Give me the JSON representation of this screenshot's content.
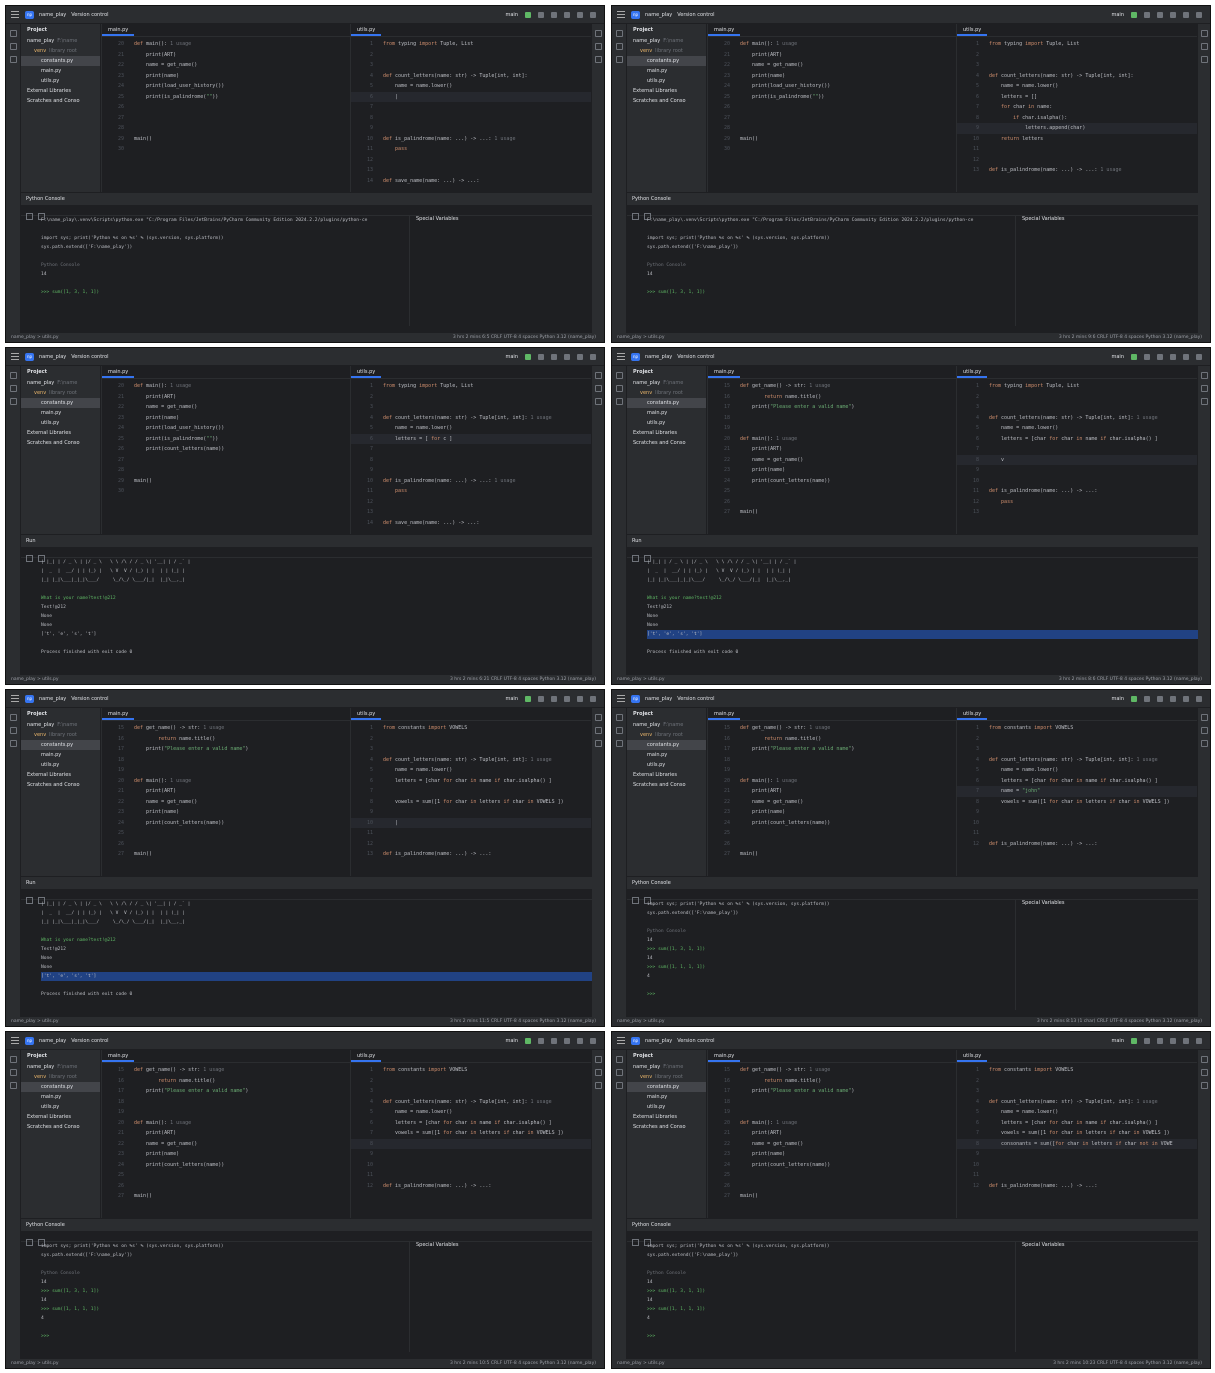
{
  "ide": {
    "project_badge": "np",
    "project_name": "name_play",
    "vcs": "Version control",
    "branch": "main",
    "panel_title": "Project",
    "tree": [
      {
        "label": "name_play",
        "suffix": "F:\\name",
        "indent": 0,
        "sel": false
      },
      {
        "label": "venv",
        "suffix": "library root",
        "indent": 1,
        "sel": false,
        "folder": true
      },
      {
        "label": "constants.py",
        "suffix": "",
        "indent": 2,
        "sel": true
      },
      {
        "label": "main.py",
        "suffix": "",
        "indent": 2,
        "sel": false
      },
      {
        "label": "utils.py",
        "suffix": "",
        "indent": 2,
        "sel": false
      },
      {
        "label": "External Libraries",
        "suffix": "",
        "indent": 0,
        "sel": false
      },
      {
        "label": "Scratches and Conso",
        "suffix": "",
        "indent": 0,
        "sel": false
      }
    ],
    "tab_main": "main.py",
    "tab_utils": "utils.py",
    "status_crumb": "name_play > utils.py",
    "console_title": "Python Console",
    "run_title": "Run",
    "run_config": "main",
    "special_vars": "Special Variables"
  },
  "code": {
    "main_a": [
      {
        "n": "20",
        "t": "def main(): 1 usage"
      },
      {
        "n": "21",
        "t": "    print(ART)"
      },
      {
        "n": "22",
        "t": "    name = get_name()"
      },
      {
        "n": "23",
        "t": "    print(name)"
      },
      {
        "n": "24",
        "t": "    print(load_user_history())"
      },
      {
        "n": "25",
        "t": "    print(is_palindrome(\"\"))"
      },
      {
        "n": "26",
        "t": ""
      },
      {
        "n": "27",
        "t": ""
      },
      {
        "n": "28",
        "t": ""
      },
      {
        "n": "29",
        "t": "main()"
      },
      {
        "n": "30",
        "t": ""
      }
    ],
    "main_b": [
      {
        "n": "20",
        "t": "def main(): 1 usage"
      },
      {
        "n": "21",
        "t": "    print(ART)"
      },
      {
        "n": "22",
        "t": "    name = get_name()"
      },
      {
        "n": "23",
        "t": "    print(name)"
      },
      {
        "n": "24",
        "t": "    print(load_user_history())"
      },
      {
        "n": "25",
        "t": "    print(is_palindrome(\"\"))"
      },
      {
        "n": "26",
        "t": "    print(count_letters(name))"
      },
      {
        "n": "27",
        "t": ""
      },
      {
        "n": "28",
        "t": ""
      },
      {
        "n": "29",
        "t": "main()"
      },
      {
        "n": "30",
        "t": ""
      }
    ],
    "main_c": [
      {
        "n": "15",
        "t": "def get_name() -> str: 1 usage"
      },
      {
        "n": "16",
        "t": "        return name.title()"
      },
      {
        "n": "17",
        "t": "    print(\"Please enter a valid name\")"
      },
      {
        "n": "18",
        "t": ""
      },
      {
        "n": "19",
        "t": ""
      },
      {
        "n": "20",
        "t": "def main(): 1 usage"
      },
      {
        "n": "21",
        "t": "    print(ART)"
      },
      {
        "n": "22",
        "t": "    name = get_name()"
      },
      {
        "n": "23",
        "t": "    print(name)"
      },
      {
        "n": "24",
        "t": "    print(count_letters(name))"
      },
      {
        "n": "25",
        "t": ""
      },
      {
        "n": "26",
        "t": ""
      },
      {
        "n": "27",
        "t": "main()"
      }
    ],
    "utils_1": [
      {
        "n": "1",
        "t": "from typing import Tuple, List"
      },
      {
        "n": "2",
        "t": ""
      },
      {
        "n": "3",
        "t": ""
      },
      {
        "n": "4",
        "t": "def count_letters(name: str) -> Tuple[int, int]:"
      },
      {
        "n": "5",
        "t": "    name = name.lower()"
      },
      {
        "n": "6",
        "t": "    |"
      },
      {
        "n": "7",
        "t": ""
      },
      {
        "n": "8",
        "t": ""
      },
      {
        "n": "9",
        "t": ""
      },
      {
        "n": "10",
        "t": "def is_palindrome(name: ...) -> ...: 1 usage"
      },
      {
        "n": "11",
        "t": "    pass"
      },
      {
        "n": "12",
        "t": ""
      },
      {
        "n": "13",
        "t": ""
      },
      {
        "n": "14",
        "t": "def save_name(name: ...) -> ...:"
      }
    ],
    "utils_2": [
      {
        "n": "1",
        "t": "from typing import Tuple, List"
      },
      {
        "n": "2",
        "t": ""
      },
      {
        "n": "3",
        "t": ""
      },
      {
        "n": "4",
        "t": "def count_letters(name: str) -> Tuple[int, int]:"
      },
      {
        "n": "5",
        "t": "    name = name.lower()"
      },
      {
        "n": "6",
        "t": "    letters = []"
      },
      {
        "n": "7",
        "t": "    for char in name:"
      },
      {
        "n": "8",
        "t": "        if char.isalpha():"
      },
      {
        "n": "9",
        "t": "            letters.append(char)"
      },
      {
        "n": "10",
        "t": "    return letters"
      },
      {
        "n": "11",
        "t": ""
      },
      {
        "n": "12",
        "t": ""
      },
      {
        "n": "13",
        "t": "def is_palindrome(name: ...) -> ...: 1 usage"
      }
    ],
    "utils_3": [
      {
        "n": "1",
        "t": "from typing import Tuple, List"
      },
      {
        "n": "2",
        "t": ""
      },
      {
        "n": "3",
        "t": ""
      },
      {
        "n": "4",
        "t": "def count_letters(name: str) -> Tuple[int, int]: 1 usage"
      },
      {
        "n": "5",
        "t": "    name = name.lower()"
      },
      {
        "n": "6",
        "t": "    letters = [ for c ]"
      },
      {
        "n": "7",
        "t": ""
      },
      {
        "n": "8",
        "t": ""
      },
      {
        "n": "9",
        "t": ""
      },
      {
        "n": "10",
        "t": "def is_palindrome(name: ...) -> ...: 1 usage"
      },
      {
        "n": "11",
        "t": "    pass"
      },
      {
        "n": "12",
        "t": ""
      },
      {
        "n": "13",
        "t": ""
      },
      {
        "n": "14",
        "t": "def save_name(name: ...) -> ...:"
      }
    ],
    "utils_4": [
      {
        "n": "1",
        "t": "from typing import Tuple, List"
      },
      {
        "n": "2",
        "t": ""
      },
      {
        "n": "3",
        "t": ""
      },
      {
        "n": "4",
        "t": "def count_letters(name: str) -> Tuple[int, int]: 1 usage"
      },
      {
        "n": "5",
        "t": "    name = name.lower()"
      },
      {
        "n": "6",
        "t": "    letters = [char for char in name if char.isalpha() ]"
      },
      {
        "n": "7",
        "t": ""
      },
      {
        "n": "8",
        "t": "    v"
      },
      {
        "n": "9",
        "t": ""
      },
      {
        "n": "10",
        "t": ""
      },
      {
        "n": "11",
        "t": "def is_palindrome(name: ...) -> ...:"
      },
      {
        "n": "12",
        "t": "    pass"
      },
      {
        "n": "13",
        "t": ""
      }
    ],
    "utils_5": [
      {
        "n": "1",
        "t": "from constants import VOWELS"
      },
      {
        "n": "2",
        "t": ""
      },
      {
        "n": "3",
        "t": ""
      },
      {
        "n": "4",
        "t": "def count_letters(name: str) -> Tuple[int, int]: 1 usage"
      },
      {
        "n": "5",
        "t": "    name = name.lower()"
      },
      {
        "n": "6",
        "t": "    letters = [char for char in name if char.isalpha() ]"
      },
      {
        "n": "7",
        "t": ""
      },
      {
        "n": "8",
        "t": "    vowels = sum([1 for char in letters if char in VOWELS ])"
      },
      {
        "n": "9",
        "t": ""
      },
      {
        "n": "10",
        "t": "    |"
      },
      {
        "n": "11",
        "t": ""
      },
      {
        "n": "12",
        "t": ""
      },
      {
        "n": "13",
        "t": "def is_palindrome(name: ...) -> ...:"
      }
    ],
    "utils_6": [
      {
        "n": "1",
        "t": "from constants import VOWELS"
      },
      {
        "n": "2",
        "t": ""
      },
      {
        "n": "3",
        "t": ""
      },
      {
        "n": "4",
        "t": "def count_letters(name: str) -> Tuple[int, int]: 1 usage"
      },
      {
        "n": "5",
        "t": "    name = name.lower()"
      },
      {
        "n": "6",
        "t": "    letters = [char for char in name if char.isalpha() ]"
      },
      {
        "n": "7",
        "t": "    name = \"john\""
      },
      {
        "n": "8",
        "t": "    vowels = sum([1 for char in letters if char in VOWELS ])"
      },
      {
        "n": "9",
        "t": ""
      },
      {
        "n": "10",
        "t": ""
      },
      {
        "n": "11",
        "t": ""
      },
      {
        "n": "12",
        "t": "def is_palindrome(name: ...) -> ...:"
      }
    ],
    "utils_7": [
      {
        "n": "1",
        "t": "from constants import VOWELS"
      },
      {
        "n": "2",
        "t": ""
      },
      {
        "n": "3",
        "t": ""
      },
      {
        "n": "4",
        "t": "def count_letters(name: str) -> Tuple[int, int]: 1 usage"
      },
      {
        "n": "5",
        "t": "    name = name.lower()"
      },
      {
        "n": "6",
        "t": "    letters = [char for char in name if char.isalpha() ]"
      },
      {
        "n": "7",
        "t": "    vowels = sum([1 for char in letters if char in VOWELS ])"
      },
      {
        "n": "8",
        "t": ""
      },
      {
        "n": "9",
        "t": ""
      },
      {
        "n": "10",
        "t": ""
      },
      {
        "n": "11",
        "t": ""
      },
      {
        "n": "12",
        "t": "def is_palindrome(name: ...) -> ...:"
      }
    ],
    "utils_8": [
      {
        "n": "1",
        "t": "from constants import VOWELS"
      },
      {
        "n": "2",
        "t": ""
      },
      {
        "n": "3",
        "t": ""
      },
      {
        "n": "4",
        "t": "def count_letters(name: str) -> Tuple[int, int]: 1 usage"
      },
      {
        "n": "5",
        "t": "    name = name.lower()"
      },
      {
        "n": "6",
        "t": "    letters = [char for char in name if char.isalpha() ]"
      },
      {
        "n": "7",
        "t": "    vowels = sum([1 for char in letters if char in VOWELS ])"
      },
      {
        "n": "8",
        "t": "    consonants = sum([for char in letters if char not in VOWE"
      },
      {
        "n": "9",
        "t": ""
      },
      {
        "n": "10",
        "t": ""
      },
      {
        "n": "11",
        "t": ""
      },
      {
        "n": "12",
        "t": "def is_palindrome(name: ...) -> ...:"
      }
    ]
  },
  "consoles": {
    "c1": [
      "F:\\name_play\\.venv\\Scripts\\python.exe \"C:/Program Files/JetBrains/PyCharm Community Edition 2024.2.2/plugins/python-ce",
      "",
      "import sys; print('Python %s on %s' % (sys.version, sys.platform))",
      "sys.path.extend(['F:\\name_play'])",
      "",
      "Python Console",
      "14",
      "",
      ">>> sum([1, 3, 1, 1])"
    ],
    "c2": [
      "F:\\name_play\\.venv\\Scripts\\python.exe \"C:/Program Files/JetBrains/PyCharm Community Edition 2024.2.2/plugins/python-ce",
      "",
      "import sys; print('Python %s on %s' % (sys.version, sys.platform))",
      "sys.path.extend(['F:\\name_play'])",
      "",
      "Python Console",
      "14",
      "",
      ">>> sum([1, 3, 1, 1])"
    ],
    "run1": [
      "| |_| | / _ \\ | |/ _ \\   \\ \\ /\\ / / _ \\| '__| | / _` |",
      "|  _  |  __/ | | (_) |   \\ V  V / (_) | |  | | (_| |",
      "|_| |_|\\___|_|_|\\___/     \\_/\\_/ \\___/|_|  |_|\\__,_|",
      "",
      "What is your name?test!@212",
      "Test!@212",
      "None",
      "None",
      "['t', 'e', 's', 't']",
      "",
      "Process finished with exit code 0"
    ],
    "c3": [
      "import sys; print('Python %s on %s' % (sys.version, sys.platform))",
      "sys.path.extend(['F:\\name_play'])",
      "",
      "Python Console",
      "14",
      ">>> sum([1, 3, 1, 1])",
      "14",
      ">>> sum([1, 1, 1, 1])",
      "4",
      "",
      ">>>"
    ]
  },
  "status": {
    "s1": "3 hrs 2 mins   6:5   CRLF   UTF-8   4 spaces   Python 3.12 (name_play)",
    "s2": "3 hrs 2 mins   9:6   CRLF   UTF-8   4 spaces   Python 3.12 (name_play)",
    "s3": "3 hrs 2 mins   6:21   CRLF   UTF-8   4 spaces   Python 3.12 (name_play)",
    "s4": "3 hrs 2 mins   8:6   CRLF   UTF-8   4 spaces   Python 3.12 (name_play)",
    "s5": "3 hrs 2 mins   11:5   CRLF   UTF-8   4 spaces   Python 3.12 (name_play)",
    "s6": "3 hrs 2 mins   8:13 (1 char)   CRLF   UTF-8   4 spaces   Python 3.12 (name_play)",
    "s7": "3 hrs 2 mins   10:5   CRLF   UTF-8   4 spaces   Python 3.12 (name_play)",
    "s8": "3 hrs 2 mins   10:23   CRLF   UTF-8   4 spaces   Python 3.12 (name_play)"
  },
  "panels": [
    {
      "main": "main_a",
      "utils": "utils_1",
      "bottom": "console",
      "out": "c1",
      "status": "s1",
      "cur": 6
    },
    {
      "main": "main_a",
      "utils": "utils_2",
      "bottom": "console",
      "out": "c2",
      "status": "s2",
      "cur": 9
    },
    {
      "main": "main_b",
      "utils": "utils_3",
      "bottom": "run",
      "out": "run1",
      "status": "s3",
      "cur": 6
    },
    {
      "main": "main_c",
      "utils": "utils_4",
      "bottom": "run",
      "out": "run1",
      "status": "s4",
      "cur": 8,
      "hl": true
    },
    {
      "main": "main_c",
      "utils": "utils_5",
      "bottom": "run",
      "out": "run1",
      "status": "s5",
      "cur": 10,
      "hl": true
    },
    {
      "main": "main_c",
      "utils": "utils_6",
      "bottom": "console",
      "out": "c3",
      "status": "s6",
      "cur": 7
    },
    {
      "main": "main_c",
      "utils": "utils_7",
      "bottom": "console",
      "out": "c3",
      "status": "s7",
      "cur": 8
    },
    {
      "main": "main_c",
      "utils": "utils_8",
      "bottom": "console",
      "out": "c3",
      "status": "s8",
      "cur": 8
    }
  ]
}
